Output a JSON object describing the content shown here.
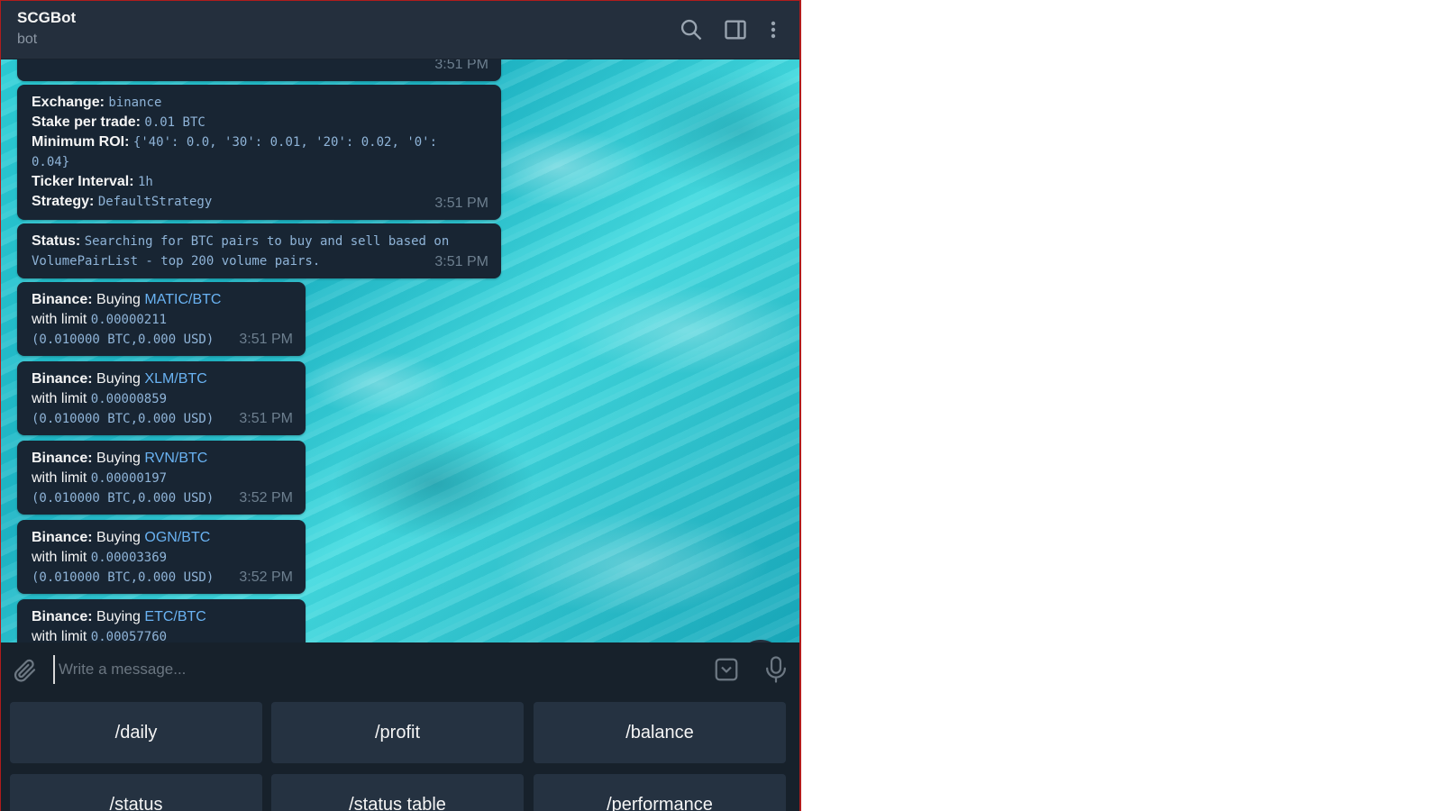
{
  "header": {
    "title": "SCGBot",
    "subtitle": "bot",
    "icons": [
      "search-icon",
      "sidebar-toggle-icon",
      "more-vertical-icon"
    ]
  },
  "messages": [
    {
      "type": "partial",
      "time": "3:51 PM"
    },
    {
      "type": "config",
      "exchange_label": "Exchange:",
      "exchange_value": "binance",
      "stake_label": "Stake per trade:",
      "stake_value": "0.01 BTC",
      "roi_label": "Minimum ROI:",
      "roi_value": "{'40': 0.0, '30': 0.01, '20': 0.02, '0':",
      "roi_value_cont": "0.04}",
      "ticker_label": "Ticker Interval:",
      "ticker_value": "1h",
      "strategy_label": "Strategy:",
      "strategy_value": "DefaultStrategy",
      "time": "3:51 PM"
    },
    {
      "type": "status",
      "label": "Status:",
      "line1": "Searching for BTC pairs to buy and sell based on",
      "line2": "VolumePairList - top 200 volume pairs.",
      "time": "3:51 PM"
    }
  ],
  "buys": [
    {
      "exchange": "Binance:",
      "action": "Buying",
      "pair": "MATIC/BTC",
      "limit_label": "with limit",
      "limit": "0.00000211",
      "amount": "(0.010000 BTC,0.000 USD)",
      "time": "3:51 PM"
    },
    {
      "exchange": "Binance:",
      "action": "Buying",
      "pair": "XLM/BTC",
      "limit_label": "with limit",
      "limit": "0.00000859",
      "amount": "(0.010000 BTC,0.000 USD)",
      "time": "3:51 PM"
    },
    {
      "exchange": "Binance:",
      "action": "Buying",
      "pair": "RVN/BTC",
      "limit_label": "with limit",
      "limit": "0.00000197",
      "amount": "(0.010000 BTC,0.000 USD)",
      "time": "3:52 PM"
    },
    {
      "exchange": "Binance:",
      "action": "Buying",
      "pair": "OGN/BTC",
      "limit_label": "with limit",
      "limit": "0.00003369",
      "amount": "(0.010000 BTC,0.000 USD)",
      "time": "3:52 PM"
    },
    {
      "exchange": "Binance:",
      "action": "Buying",
      "pair": "ETC/BTC",
      "limit_label": "with limit",
      "limit": "0.00057760"
    }
  ],
  "composer": {
    "placeholder": "Write a message..."
  },
  "keyboard": {
    "row1": [
      "/daily",
      "/profit",
      "/balance"
    ],
    "row2": [
      "/status",
      "/status table",
      "/performance"
    ]
  },
  "colors": {
    "app_bg": "#17212b",
    "header_bg": "#242f3d",
    "bubble_bg": "#182533",
    "link": "#6ab3f3",
    "mono": "#8fb4d8",
    "button_bg": "#253241"
  }
}
